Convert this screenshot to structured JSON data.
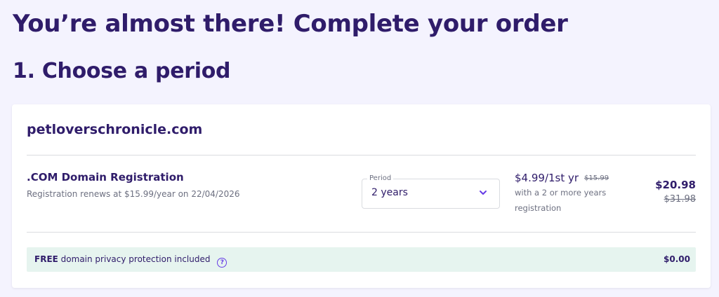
{
  "header": {
    "title": "You’re almost there! Complete your order",
    "section_title": "1. Choose a period"
  },
  "order": {
    "domain": "petloverschronicle.com",
    "product_title": ".COM Domain Registration",
    "renew_note": "Registration renews at $15.99/year on 22/04/2026",
    "period": {
      "label": "Period",
      "selected": "2 years",
      "icon": "chevron-down-icon"
    },
    "price": {
      "main": "$4.99/1st yr",
      "original": "$15.99",
      "note": "with a 2 or more years registration"
    },
    "total": "$20.98",
    "total_original": "$31.98"
  },
  "privacy": {
    "free_label": "FREE",
    "text": "domain privacy protection included",
    "help_icon": "question-circle-icon",
    "price": "$0.00"
  },
  "colors": {
    "page_background": "#f4f3fe",
    "text_primary": "#2f1c6a",
    "accent": "#673de6",
    "privacy_background": "#e6f4ef"
  }
}
